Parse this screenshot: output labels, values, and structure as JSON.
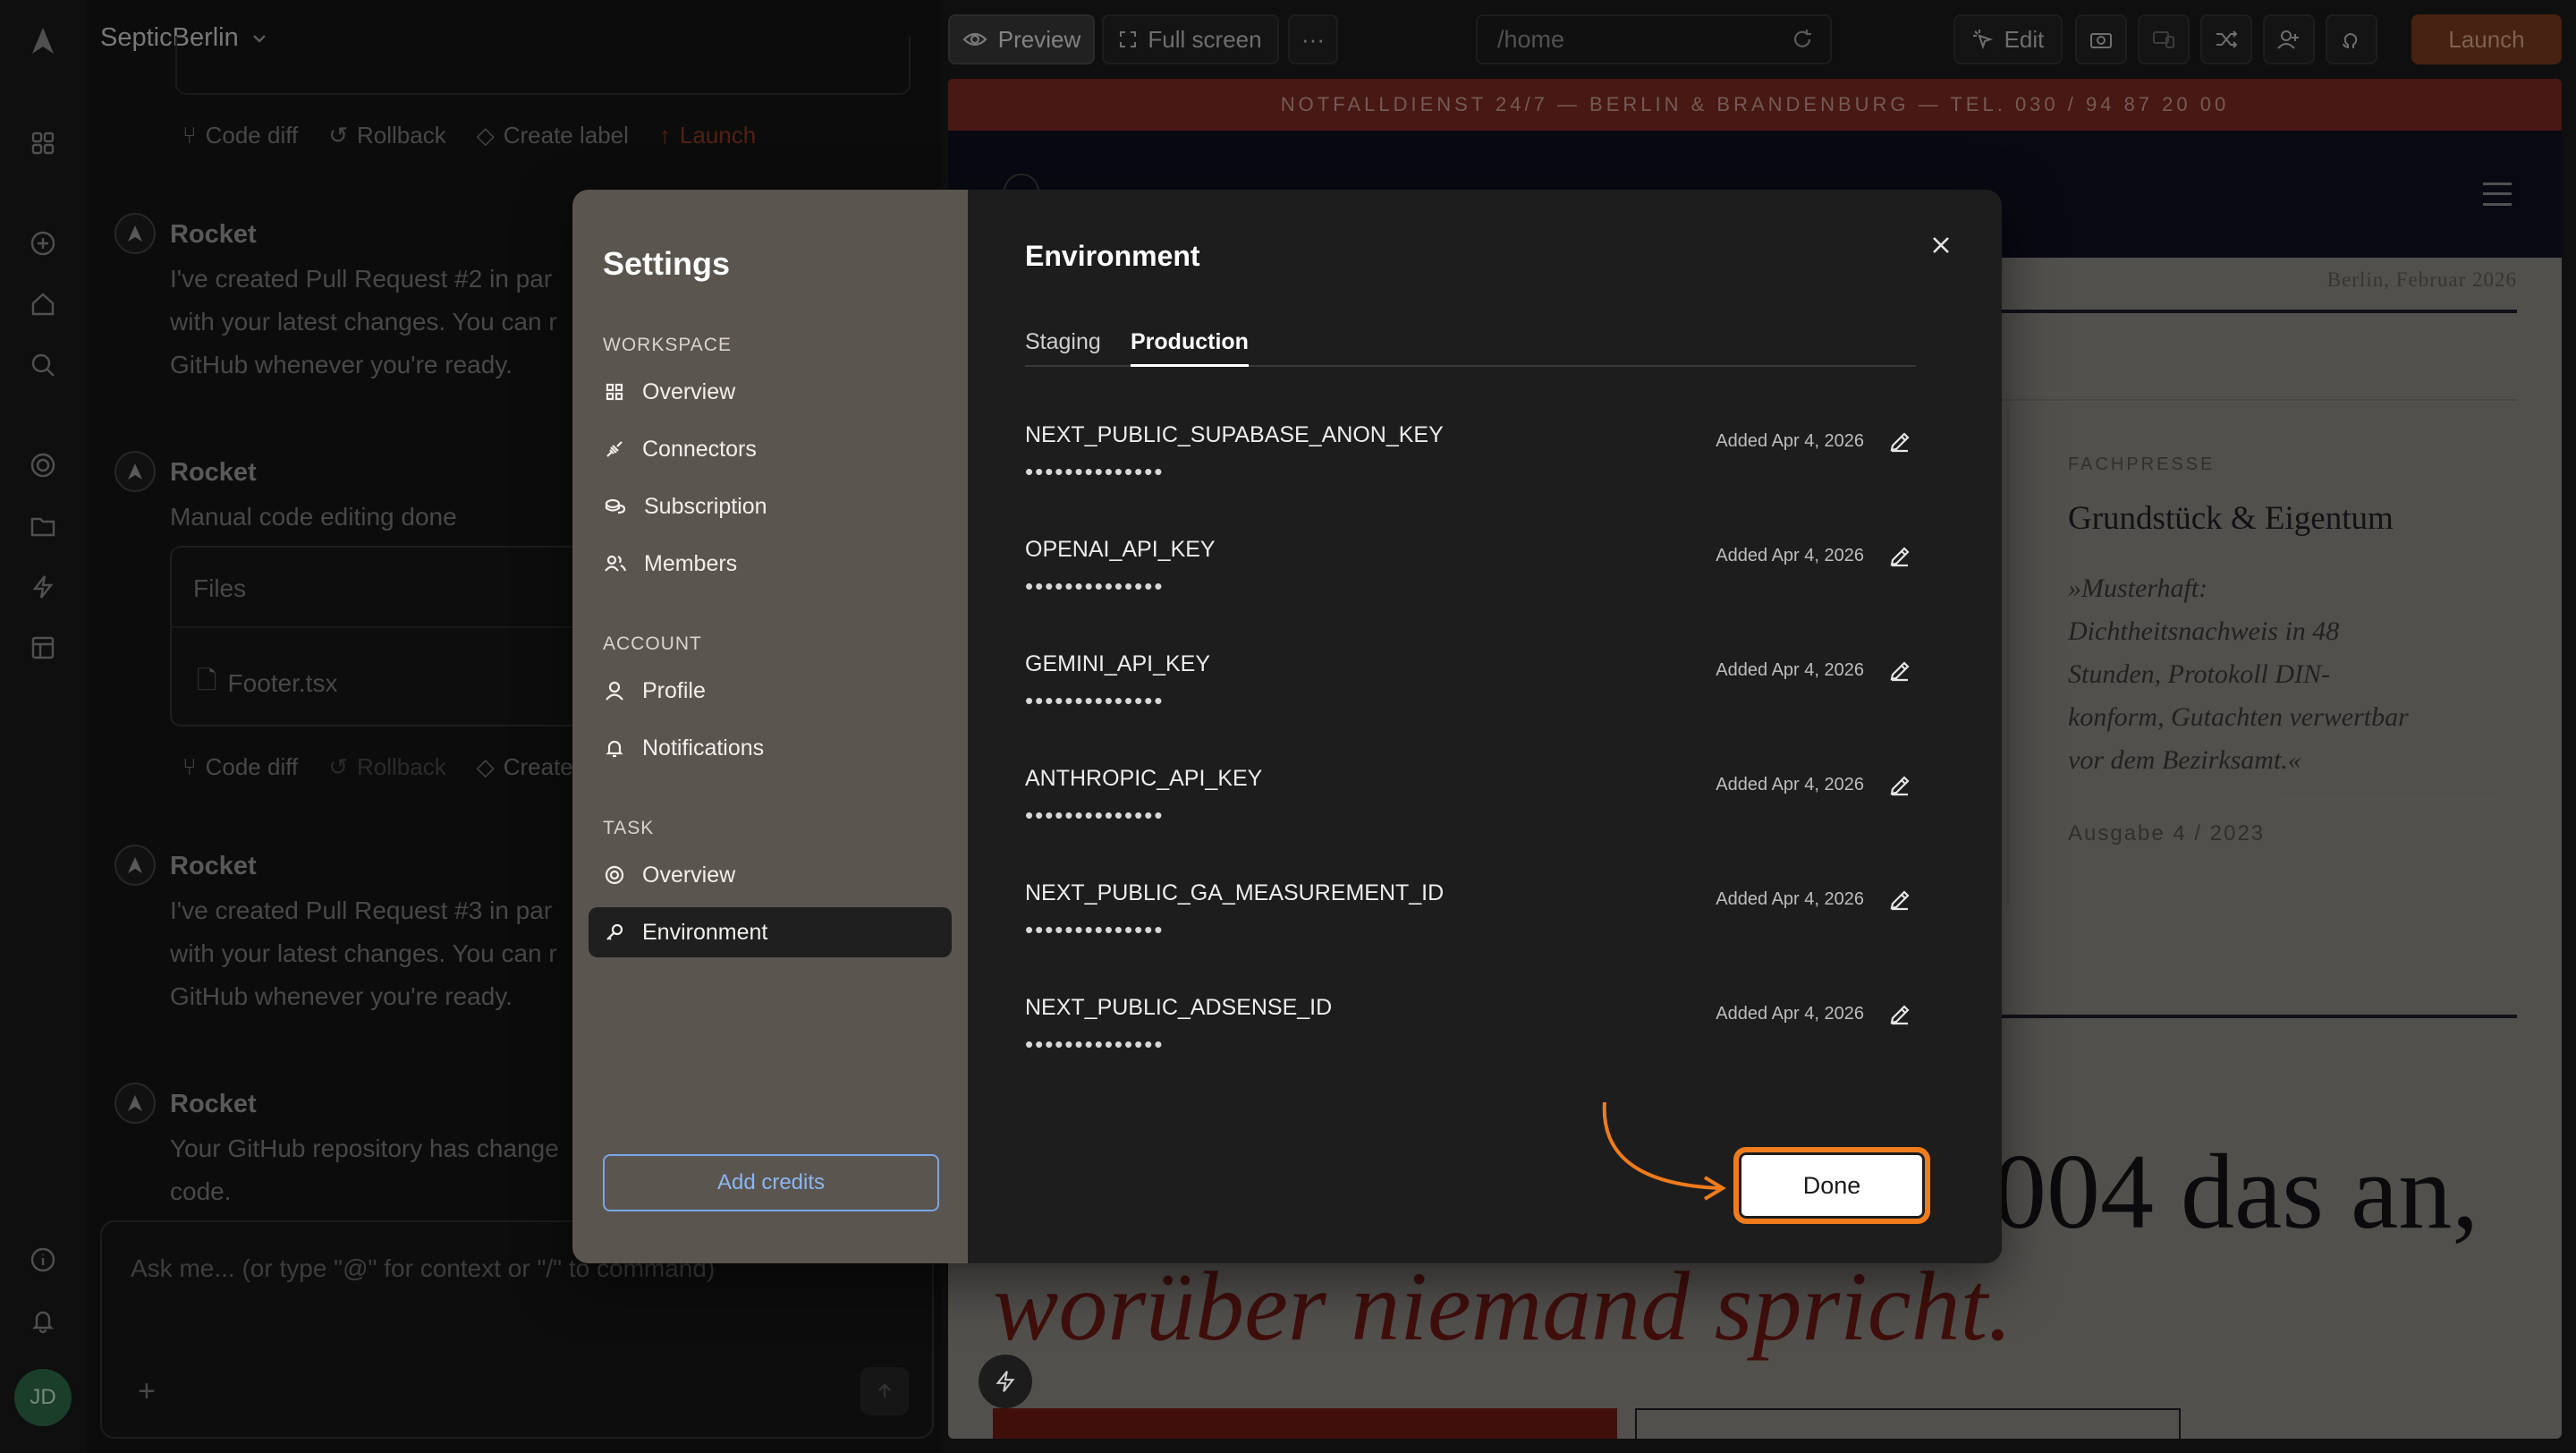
{
  "project": {
    "name": "SepticBerlin"
  },
  "chat": {
    "actions1": {
      "code_diff": "Code diff",
      "rollback": "Rollback",
      "create_label": "Create label",
      "launch": "Launch"
    },
    "messages": [
      {
        "author": "Rocket",
        "lines": [
          "I've created Pull Request #2 in par",
          "with your latest changes. You can r",
          "GitHub whenever you're ready."
        ]
      },
      {
        "author": "Rocket",
        "lines": [
          "Manual code editing done"
        ],
        "files_label": "Files",
        "file": "Footer.tsx"
      },
      {
        "author": "Rocket",
        "lines": [
          "I've created Pull Request #3 in par",
          "with your latest changes. You can r",
          "GitHub whenever you're ready."
        ]
      },
      {
        "author": "Rocket",
        "lines": [
          "Your GitHub repository has change",
          "code."
        ]
      }
    ],
    "actions2": {
      "code_diff": "Code diff",
      "rollback": "Rollback",
      "create_label": "Create"
    },
    "input_placeholder": "Ask me... (or type \"@\" for context or \"/\" to command)",
    "avatar_initials": "JD"
  },
  "toolbar": {
    "preview": "Preview",
    "full_screen": "Full screen",
    "more": "···",
    "url": "/home",
    "edit": "Edit",
    "launch": "Launch"
  },
  "preview_site": {
    "banner": "NOTFALLDIENST 24/7 — BERLIN & BRANDENBURG — TEL. 030 / 94 87 20 00",
    "dateline": "Berlin, Februar 2026",
    "press_kicker": "FACHPRESSE",
    "press_title": "Grundstück & Eigentum",
    "press_quote": [
      "»Musterhaft:",
      "Dichtheitsnachweis in 48",
      "Stunden, Protokoll DIN-",
      "konform, Gutachten verwertbar",
      "vor dem Bezirksamt.«"
    ],
    "press_issue": "Ausgabe 4 / 2023",
    "headline_fragment": "004 das an,",
    "headline_red": "worüber niemand spricht."
  },
  "settings": {
    "title": "Settings",
    "sections": {
      "workspace": "WORKSPACE",
      "account": "ACCOUNT",
      "task": "TASK"
    },
    "items": {
      "overview": "Overview",
      "connectors": "Connectors",
      "subscription": "Subscription",
      "members": "Members",
      "profile": "Profile",
      "notifications": "Notifications",
      "task_overview": "Overview",
      "environment": "Environment"
    },
    "add_credits": "Add credits",
    "panel_title": "Environment",
    "tabs": {
      "staging": "Staging",
      "production": "Production",
      "active": "Production"
    },
    "env_vars": [
      {
        "name": "NEXT_PUBLIC_SUPABASE_ANON_KEY",
        "value": "••••••••••••••",
        "added": "Added Apr 4, 2026"
      },
      {
        "name": "OPENAI_API_KEY",
        "value": "••••••••••••••",
        "added": "Added Apr 4, 2026"
      },
      {
        "name": "GEMINI_API_KEY",
        "value": "••••••••••••••",
        "added": "Added Apr 4, 2026"
      },
      {
        "name": "ANTHROPIC_API_KEY",
        "value": "••••••••••••••",
        "added": "Added Apr 4, 2026"
      },
      {
        "name": "NEXT_PUBLIC_GA_MEASUREMENT_ID",
        "value": "••••••••••••••",
        "added": "Added Apr 4, 2026"
      },
      {
        "name": "NEXT_PUBLIC_ADSENSE_ID",
        "value": "••••••••••••••",
        "added": "Added Apr 4, 2026"
      }
    ],
    "done": "Done",
    "highlight_color": "#f07c1b"
  }
}
